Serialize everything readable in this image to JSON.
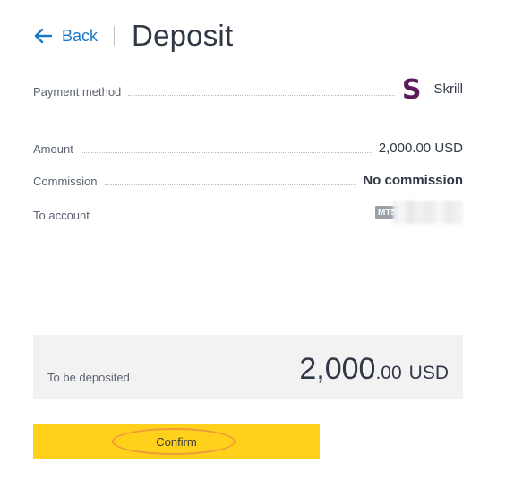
{
  "header": {
    "back_label": "Back",
    "title": "Deposit"
  },
  "payment_method": {
    "label": "Payment method",
    "logo_letter": "S",
    "name": "Skrill",
    "brand_color": "#5c1a5c"
  },
  "details": {
    "amount_label": "Amount",
    "amount_value": "2,000.00 USD",
    "commission_label": "Commission",
    "commission_value": "No commission",
    "account_label": "To account",
    "account_type": "MT5"
  },
  "summary": {
    "label": "To be deposited",
    "amount_integer": "2,000",
    "amount_decimal": ".00",
    "currency": "USD"
  },
  "confirm": {
    "label": "Confirm",
    "color": "#ffd11a"
  },
  "colors": {
    "link": "#1877c9",
    "text": "#2f3844",
    "highlight": "#f09a3a"
  },
  "icons": {
    "back": "arrow-left-icon"
  }
}
